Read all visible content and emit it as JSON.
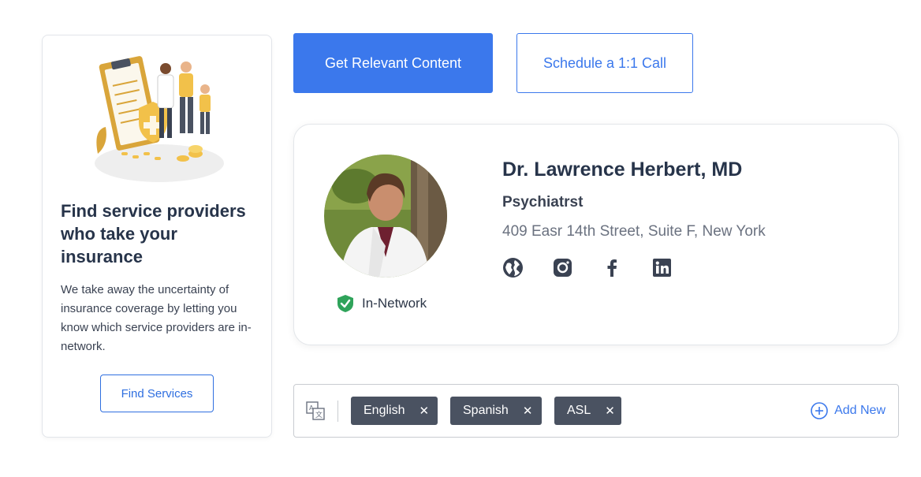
{
  "left_card": {
    "title": "Find service providers who take your insurance",
    "description": "We take away the uncertainty of insurance coverage by letting you know which service providers are in-network.",
    "button_label": "Find Services"
  },
  "actions": {
    "primary_label": "Get Relevant Content",
    "secondary_label": "Schedule a 1:1 Call"
  },
  "provider": {
    "name": "Dr. Lawrence Herbert, MD",
    "specialty": "Psychiatrst",
    "address": "409 Easr 14th Street, Suite F, New York",
    "network_status": "In-Network",
    "socials": [
      "globe-icon",
      "instagram-icon",
      "facebook-icon",
      "linkedin-icon"
    ]
  },
  "languages": {
    "chips": [
      {
        "label": "English",
        "remove": "✕"
      },
      {
        "label": "Spanish",
        "remove": "✕"
      },
      {
        "label": "ASL",
        "remove": "✕"
      }
    ],
    "add_label": "Add New"
  },
  "colors": {
    "accent": "#3b78ec",
    "chip_bg": "#4a5261",
    "network_green": "#2fa35a",
    "heading": "#27344a"
  }
}
